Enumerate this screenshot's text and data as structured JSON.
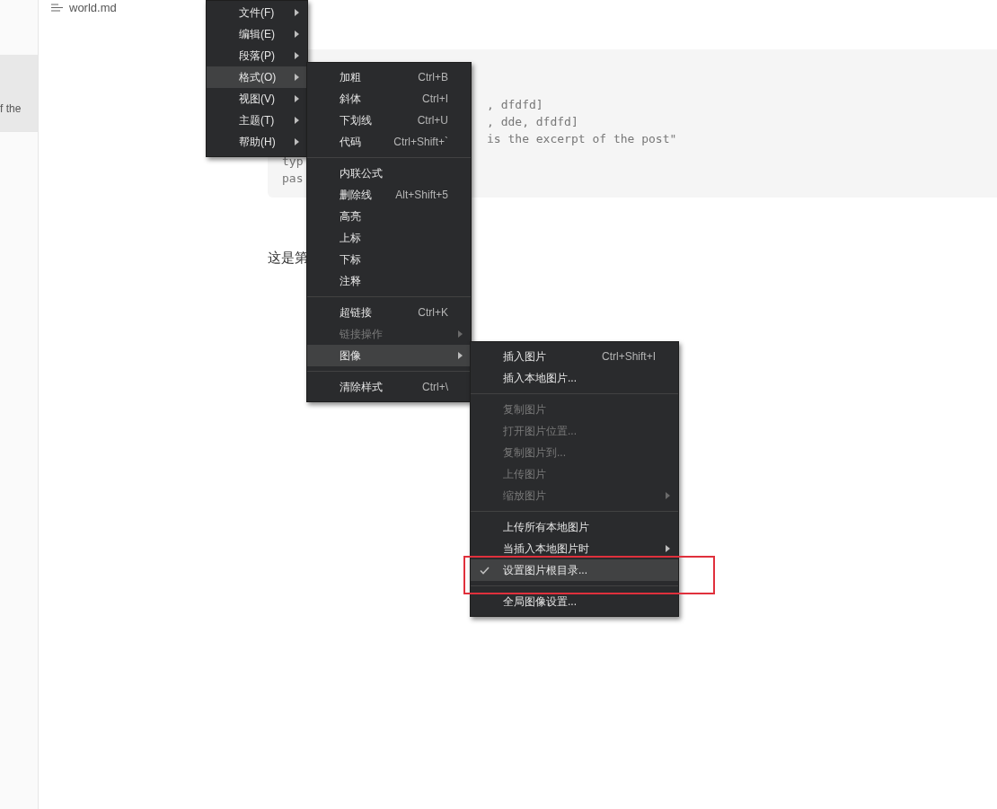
{
  "file": {
    "name": "world.md"
  },
  "sidebar": {
    "items": [
      {
        "excerpt": "f the",
        "selected": true
      }
    ]
  },
  "code_block": {
    "lines": [
      ", dfdfd]",
      ", dde, dfdfd]",
      "is the excerpt of the post\"",
      "typ",
      "pas"
    ]
  },
  "paragraph": "这是第",
  "menus": [
    {
      "items": [
        {
          "kind": "item",
          "label": "文件(F)",
          "submenu": true,
          "selected": false,
          "disabled": false
        },
        {
          "kind": "item",
          "label": "编辑(E)",
          "submenu": true,
          "selected": false,
          "disabled": false
        },
        {
          "kind": "item",
          "label": "段落(P)",
          "submenu": true,
          "selected": false,
          "disabled": false
        },
        {
          "kind": "item",
          "label": "格式(O)",
          "submenu": true,
          "selected": true,
          "disabled": false
        },
        {
          "kind": "item",
          "label": "视图(V)",
          "submenu": true,
          "selected": false,
          "disabled": false
        },
        {
          "kind": "item",
          "label": "主题(T)",
          "submenu": true,
          "selected": false,
          "disabled": false
        },
        {
          "kind": "item",
          "label": "帮助(H)",
          "submenu": true,
          "selected": false,
          "disabled": false
        }
      ]
    },
    {
      "items": [
        {
          "kind": "item",
          "label": "加粗",
          "shortcut": "Ctrl+B",
          "selected": false,
          "disabled": false
        },
        {
          "kind": "item",
          "label": "斜体",
          "shortcut": "Ctrl+I",
          "selected": false,
          "disabled": false
        },
        {
          "kind": "item",
          "label": "下划线",
          "shortcut": "Ctrl+U",
          "selected": false,
          "disabled": false
        },
        {
          "kind": "item",
          "label": "代码",
          "shortcut": "Ctrl+Shift+`",
          "selected": false,
          "disabled": false
        },
        {
          "kind": "separator"
        },
        {
          "kind": "item",
          "label": "内联公式",
          "selected": false,
          "disabled": false
        },
        {
          "kind": "item",
          "label": "删除线",
          "shortcut": "Alt+Shift+5",
          "selected": false,
          "disabled": false
        },
        {
          "kind": "item",
          "label": "高亮",
          "selected": false,
          "disabled": false
        },
        {
          "kind": "item",
          "label": "上标",
          "selected": false,
          "disabled": false
        },
        {
          "kind": "item",
          "label": "下标",
          "selected": false,
          "disabled": false
        },
        {
          "kind": "item",
          "label": "注释",
          "selected": false,
          "disabled": false
        },
        {
          "kind": "separator"
        },
        {
          "kind": "item",
          "label": "超链接",
          "shortcut": "Ctrl+K",
          "selected": false,
          "disabled": false
        },
        {
          "kind": "item",
          "label": "链接操作",
          "submenu": true,
          "selected": false,
          "disabled": true
        },
        {
          "kind": "item",
          "label": "图像",
          "submenu": true,
          "selected": true,
          "disabled": false
        },
        {
          "kind": "separator"
        },
        {
          "kind": "item",
          "label": "清除样式",
          "shortcut": "Ctrl+\\",
          "selected": false,
          "disabled": false
        }
      ]
    },
    {
      "items": [
        {
          "kind": "item",
          "label": "插入图片",
          "shortcut": "Ctrl+Shift+I",
          "selected": false,
          "disabled": false,
          "checked": false
        },
        {
          "kind": "item",
          "label": "插入本地图片...",
          "selected": false,
          "disabled": false,
          "checked": false
        },
        {
          "kind": "separator"
        },
        {
          "kind": "item",
          "label": "复制图片",
          "selected": false,
          "disabled": true,
          "checked": false
        },
        {
          "kind": "item",
          "label": "打开图片位置...",
          "selected": false,
          "disabled": true,
          "checked": false
        },
        {
          "kind": "item",
          "label": "复制图片到...",
          "selected": false,
          "disabled": true,
          "checked": false
        },
        {
          "kind": "item",
          "label": "上传图片",
          "selected": false,
          "disabled": true,
          "checked": false
        },
        {
          "kind": "item",
          "label": "缩放图片",
          "submenu": true,
          "selected": false,
          "disabled": true,
          "checked": false
        },
        {
          "kind": "separator"
        },
        {
          "kind": "item",
          "label": "上传所有本地图片",
          "selected": false,
          "disabled": false,
          "checked": false
        },
        {
          "kind": "item",
          "label": "当插入本地图片时",
          "submenu": true,
          "selected": false,
          "disabled": false,
          "checked": false
        },
        {
          "kind": "item",
          "label": "设置图片根目录...",
          "selected": true,
          "disabled": false,
          "checked": true
        },
        {
          "kind": "separator"
        },
        {
          "kind": "item",
          "label": "全局图像设置...",
          "selected": false,
          "disabled": false,
          "checked": false
        }
      ]
    }
  ],
  "annotation": {
    "kind": "frame"
  }
}
